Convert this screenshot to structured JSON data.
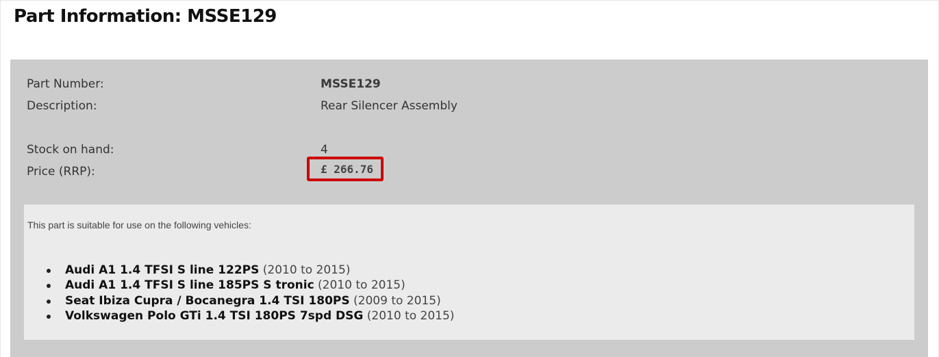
{
  "page": {
    "title": "Part Information: MSSE129"
  },
  "part": {
    "part_number_label": "Part Number:",
    "part_number": "MSSE129",
    "description_label": "Description:",
    "description": "Rear Silencer Assembly",
    "stock_label": "Stock on hand:",
    "stock": "4",
    "price_label": "Price (RRP):",
    "price": "£ 266.76",
    "price_highlight_color": "#cc0000"
  },
  "vehicles": {
    "intro": "This part is suitable for use on the following vehicles:",
    "items": [
      {
        "name": "Audi A1 1.4 TFSI S line 122PS",
        "years": "(2010 to 2015)"
      },
      {
        "name": "Audi A1 1.4 TFSI S line 185PS S tronic",
        "years": "(2010 to 2015)"
      },
      {
        "name": "Seat Ibiza Cupra / Bocanegra 1.4 TSI 180PS",
        "years": "(2009 to 2015)"
      },
      {
        "name": "Volkswagen Polo GTi 1.4 TSI 180PS 7spd DSG",
        "years": "(2010 to 2015)"
      }
    ]
  }
}
